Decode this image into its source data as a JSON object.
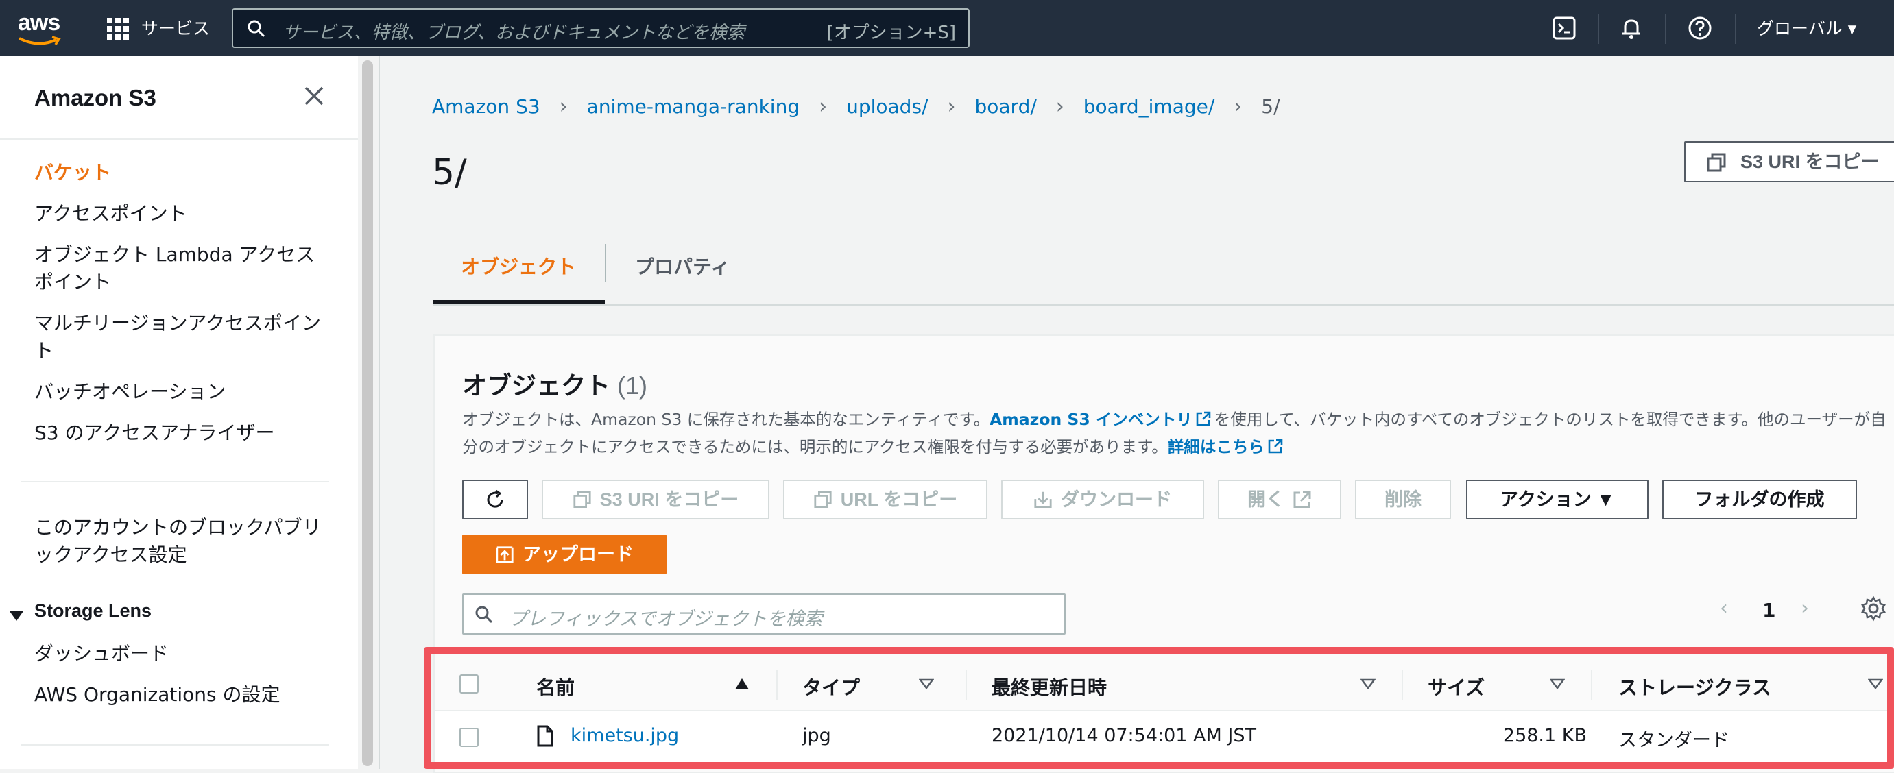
{
  "topbar": {
    "logo_text": "aws",
    "services_label": "サービス",
    "search_placeholder": "サービス、特徴、ブログ、およびドキュメントなどを検索",
    "search_hint": "[オプション+S]",
    "region_label": "グローバル ▾",
    "icons": [
      "cloudshell-icon",
      "bell-icon",
      "help-icon"
    ]
  },
  "sidebar": {
    "title": "Amazon S3",
    "items": [
      {
        "label": "バケット",
        "active": true
      },
      {
        "label": "アクセスポイント"
      },
      {
        "label": "オブジェクト Lambda アクセスポイント"
      },
      {
        "label": "マルチリージョンアクセスポイント"
      },
      {
        "label": "バッチオペレーション"
      },
      {
        "label": "S3 のアクセスアナライザー"
      }
    ],
    "block_public_access": "このアカウントのブロックパブリックアクセス設定",
    "storage_lens": {
      "label": "Storage Lens",
      "items": [
        "ダッシュボード",
        "AWS Organizations の設定"
      ]
    }
  },
  "breadcrumb": [
    "Amazon S3",
    "anime-manga-ranking",
    "uploads/",
    "board/",
    "board_image/",
    "5/"
  ],
  "page_title": "5/",
  "copy_uri_label": "S3 URI をコピー",
  "tabs": [
    {
      "label": "オブジェクト",
      "active": true
    },
    {
      "label": "プロパティ"
    }
  ],
  "objects_panel": {
    "title": "オブジェクト",
    "count": "(1)",
    "desc_1": "オブジェクトは、Amazon S3 に保存された基本的なエンティティです。",
    "desc_link_1": "Amazon S3 インベントリ",
    "desc_2": "を使用して、バケット内のすべてのオブジェクトのリストを取得できます。他のユーザーが自分のオブジェクトにアクセスできるためには、明示的にアクセス権限を付与する必要があります。",
    "desc_link_2": "詳細はこちら",
    "buttons": {
      "copy_s3_uri": "S3 URI をコピー",
      "copy_url": "URL をコピー",
      "download": "ダウンロード",
      "open": "開く",
      "delete": "削除",
      "actions": "アクション ▼",
      "create_folder": "フォルダの作成",
      "upload": "アップロード"
    },
    "filter_placeholder": "プレフィックスでオブジェクトを検索",
    "page": "1",
    "columns": [
      "名前",
      "タイプ",
      "最終更新日時",
      "サイズ",
      "ストレージクラス"
    ],
    "rows": [
      {
        "name": "kimetsu.jpg",
        "type": "jpg",
        "modified": "2021/10/14 07:54:01 AM JST",
        "size": "258.1 KB",
        "storage_class": "スタンダード"
      }
    ]
  },
  "colors": {
    "accent": "#ec7211",
    "link": "#0073bb",
    "topbar": "#232f3e",
    "highlight": "#f0525b"
  }
}
